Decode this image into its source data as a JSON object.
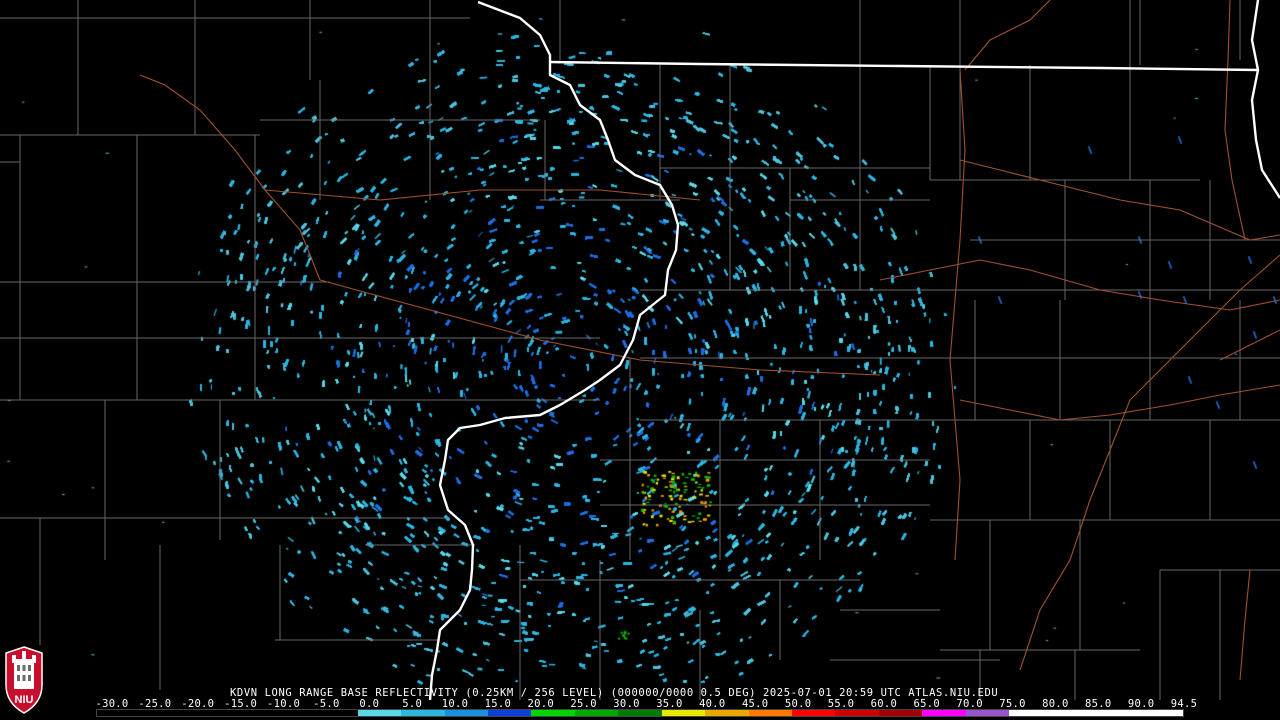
{
  "product": {
    "radar_id": "KDVN",
    "title": "KDVN LONG RANGE BASE REFLECTIVITY (0.25KM / 256 LEVEL) (000000/0000 0.5 DEG) 2025-07-01 20:59 UTC  ATLAS.NIU.EDU",
    "elevation_deg": 0.5,
    "date": "2025-07-01",
    "time_utc": "20:59"
  },
  "logo": {
    "text": "NIU",
    "colors": {
      "red": "#c8102e",
      "white": "#ffffff",
      "gray": "#6b6b6b"
    }
  },
  "colorbar": {
    "labels": [
      "-30.0",
      "-25.0",
      "-20.0",
      "-15.0",
      "-10.0",
      "-5.0",
      "0.0",
      "5.0",
      "10.0",
      "15.0",
      "20.0",
      "25.0",
      "30.0",
      "35.0",
      "40.0",
      "45.0",
      "50.0",
      "55.0",
      "60.0",
      "65.0",
      "70.0",
      "75.0",
      "80.0",
      "85.0",
      "90.0",
      "94.5"
    ],
    "colors": [
      "#000000",
      "#000000",
      "#000000",
      "#000000",
      "#000000",
      "#000000",
      "#5ad8e6",
      "#2cb8dc",
      "#1a8fe0",
      "#0c3fdc",
      "#00d400",
      "#00a800",
      "#007a00",
      "#e8e800",
      "#e8a800",
      "#ff7a00",
      "#ff0000",
      "#cc0000",
      "#a00000",
      "#ff00ff",
      "#9955cc",
      "#ffffff",
      "#ffffff",
      "#ffffff",
      "#ffffff"
    ]
  },
  "map": {
    "state_border_color": "#ffffff",
    "county_line_color": "#7a7a7a",
    "highway_color": "#a0522d",
    "radar_site_color": "#000000"
  },
  "radar_echo": {
    "center": [
      568,
      365
    ],
    "radius": 370,
    "inner_color": "#1f6fe0",
    "mid_color": "#2fb6e2",
    "outer_color": "#5ad8e6",
    "weak_color": "#4fc3dd",
    "strong_colors": [
      "#00c000",
      "#e8e800",
      "#f0a000"
    ]
  }
}
